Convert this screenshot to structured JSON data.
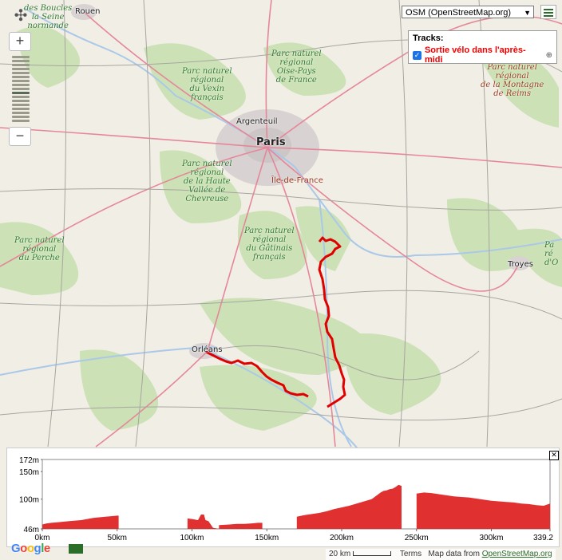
{
  "map": {
    "cities": [
      {
        "id": "rouen",
        "label": "Rouen"
      },
      {
        "id": "argenteuil",
        "label": "Argenteuil"
      },
      {
        "id": "paris",
        "label": "Paris"
      },
      {
        "id": "iledefrance",
        "label": "Île-de-France"
      },
      {
        "id": "orleans",
        "label": "Orléans"
      },
      {
        "id": "troyes",
        "label": "Troyes"
      }
    ],
    "parks": [
      {
        "id": "boucles",
        "label": "des Boucles\nla Seine\nnormande"
      },
      {
        "id": "oise",
        "label": "Parc naturel\nrégional\nOise-Pays\nde France"
      },
      {
        "id": "vexin",
        "label": "Parc naturel\nrégional\ndu Vexin\nfrançais"
      },
      {
        "id": "reims",
        "label": "Parc naturel\nrégional\nde la Montagne\nde Reims"
      },
      {
        "id": "chevreuse",
        "label": "Parc naturel\nrégional\nde la Haute\nVallée de\nChevreuse"
      },
      {
        "id": "gatinais",
        "label": "Parc naturel\nrégional\ndu Gâtinais\nfrançais"
      },
      {
        "id": "perche",
        "label": "Parc naturel\nrégional\ndu Perche"
      },
      {
        "id": "east",
        "label": "Pa\nré\nd'O"
      }
    ],
    "track_color": "#e00000"
  },
  "controls": {
    "maptype": "OSM (OpenStreetMap.org)",
    "zoom_in": "+",
    "zoom_out": "−",
    "menu_icon": "hamburger-icon",
    "compass_icon": "pan-compass-icon"
  },
  "tracks": {
    "title": "Tracks:",
    "items": [
      {
        "name": "Sortie vélo dans l'après-midi",
        "checked": true
      }
    ]
  },
  "profile": {
    "close": "✕",
    "color": "#e03030",
    "yticks": [
      "172m",
      "150m",
      "100m",
      "46m"
    ],
    "xticks": [
      "0km",
      "50km",
      "100km",
      "150km",
      "200km",
      "250km",
      "300km",
      "339.2"
    ]
  },
  "footer": {
    "google": "Google",
    "scale": "20 km",
    "terms": "Terms",
    "data_prefix": "Map data from",
    "data_link": "OpenStreetMap.org"
  }
}
